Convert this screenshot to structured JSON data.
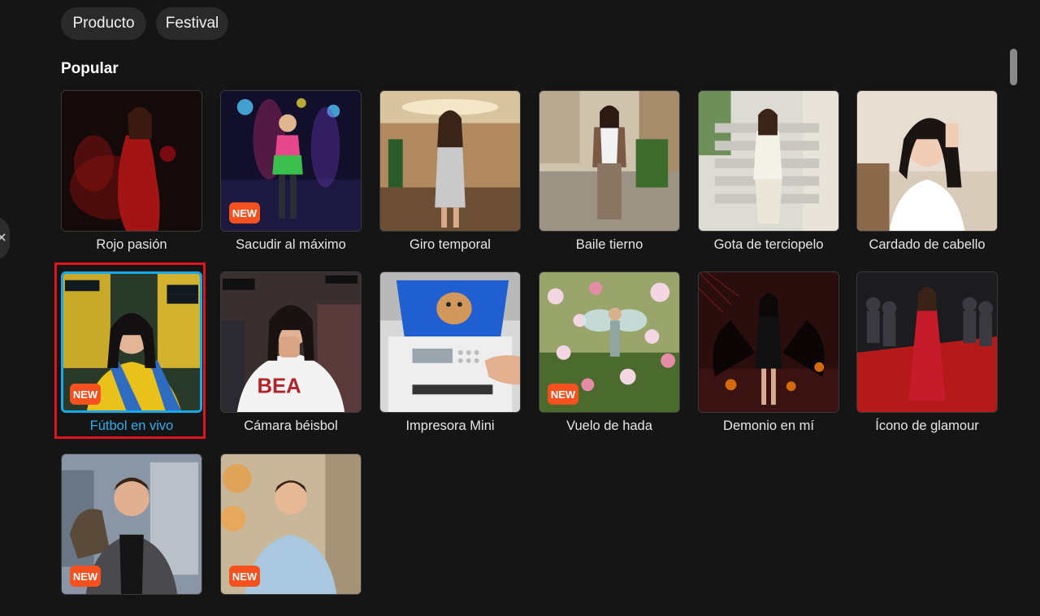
{
  "filters": [
    {
      "label": "Producto"
    },
    {
      "label": "Festival"
    }
  ],
  "section": {
    "title": "Popular"
  },
  "badge_text": "NEW",
  "side_handle_icon": "close-icon",
  "colors": {
    "badge": "#f4511e",
    "selected_border": "#19a8e8",
    "highlight": "#e0141e"
  },
  "templates": [
    {
      "label": "Rojo pasión",
      "new": false,
      "selected": false,
      "icon": "template-thumbnail"
    },
    {
      "label": "Sacudir al máximo",
      "new": true,
      "selected": false,
      "icon": "template-thumbnail"
    },
    {
      "label": "Giro temporal",
      "new": false,
      "selected": false,
      "icon": "template-thumbnail"
    },
    {
      "label": "Baile tierno",
      "new": false,
      "selected": false,
      "icon": "template-thumbnail"
    },
    {
      "label": "Gota de terciopelo",
      "new": false,
      "selected": false,
      "icon": "template-thumbnail"
    },
    {
      "label": "Cardado de cabello",
      "new": false,
      "selected": false,
      "icon": "template-thumbnail"
    },
    {
      "label": "Fútbol en vivo",
      "new": true,
      "selected": true,
      "icon": "template-thumbnail"
    },
    {
      "label": "Cámara béisbol",
      "new": false,
      "selected": false,
      "icon": "template-thumbnail"
    },
    {
      "label": "Impresora Mini",
      "new": false,
      "selected": false,
      "icon": "template-thumbnail"
    },
    {
      "label": "Vuelo de hada",
      "new": true,
      "selected": false,
      "icon": "template-thumbnail"
    },
    {
      "label": "Demonio en mí",
      "new": false,
      "selected": false,
      "icon": "template-thumbnail"
    },
    {
      "label": "Ícono de glamour",
      "new": false,
      "selected": false,
      "icon": "template-thumbnail"
    },
    {
      "label": "",
      "new": true,
      "selected": false,
      "icon": "template-thumbnail"
    },
    {
      "label": "",
      "new": true,
      "selected": false,
      "icon": "template-thumbnail"
    }
  ]
}
